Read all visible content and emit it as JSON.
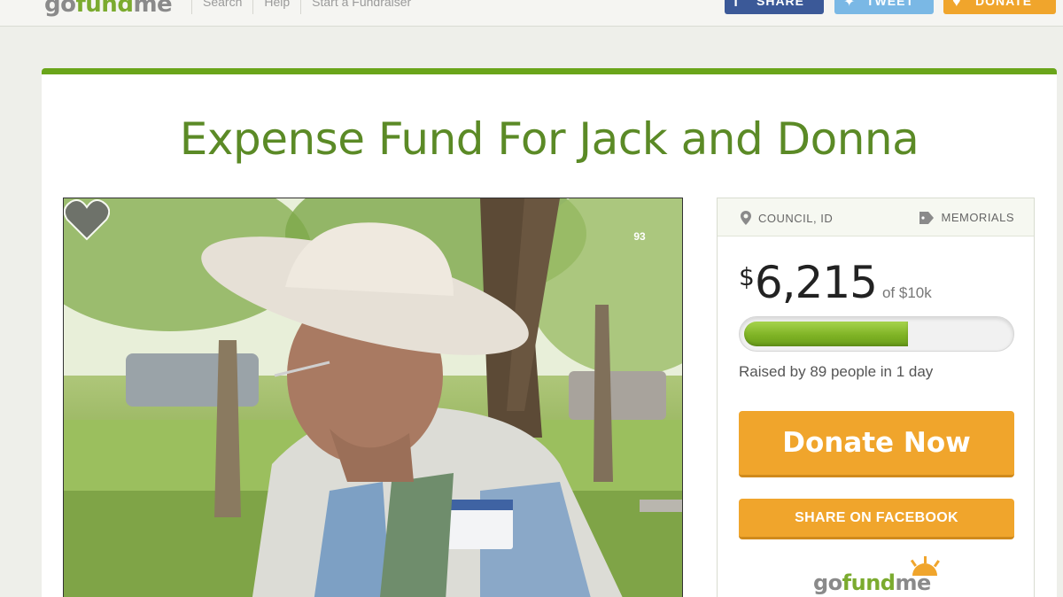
{
  "brand": {
    "logo_go": "go",
    "logo_fund": "fund",
    "logo_me": "me"
  },
  "nav": {
    "links": [
      "Search",
      "Help",
      "Start a Fundraiser"
    ]
  },
  "top_buttons": {
    "share": "SHARE",
    "tweet": "TWEET",
    "donate": "DONATE"
  },
  "campaign": {
    "title": "Expense Fund For Jack and Donna",
    "hearts": "93",
    "location": "COUNCIL, ID",
    "category": "MEMORIALS",
    "currency": "$",
    "raised": "6,215",
    "goal_text": "of $10k",
    "progress_fraction": 0.62,
    "raised_by_prefix": "Raised by ",
    "raised_by_people": "89",
    "raised_by_mid": " people in ",
    "raised_by_days": "1",
    "raised_by_suffix": " day",
    "donate_label": "Donate Now",
    "share_fb_label": "SHARE ON FACEBOOK"
  },
  "colors": {
    "brand_green": "#6aa51a",
    "title_green": "#5b8a26",
    "donate_orange": "#f0a52c",
    "facebook_blue": "#3b5998",
    "twitter_blue": "#7ab8e5"
  }
}
